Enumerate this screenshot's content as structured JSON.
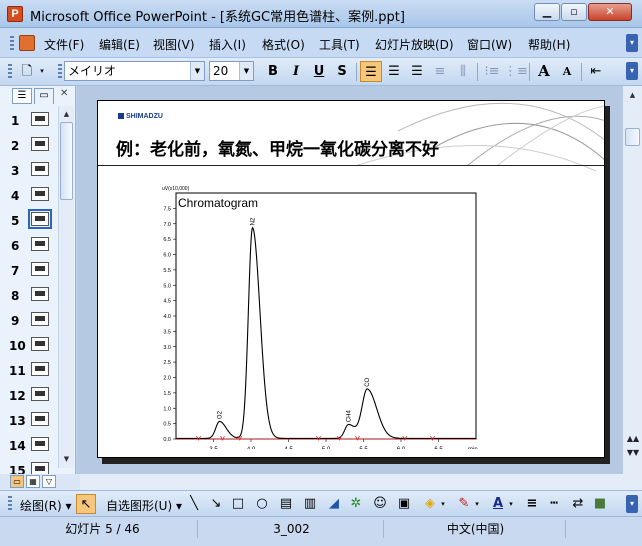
{
  "window": {
    "title": "Microsoft Office PowerPoint - [系统GC常用色谱柱、案例.ppt]",
    "minimize": "▁",
    "restore": "▫",
    "close": "✕"
  },
  "menu": [
    "文件(F)",
    "编辑(E)",
    "视图(V)",
    "插入(I)",
    "格式(O)",
    "工具(T)",
    "幻灯片放映(D)",
    "窗口(W)",
    "帮助(H)"
  ],
  "toolbar": {
    "font_name": "メイリオ",
    "font_size": "20",
    "bold": "B",
    "italic": "I",
    "underline": "U",
    "shadow": "S",
    "grow_font": "A",
    "shrink_font": "A"
  },
  "slides": {
    "numbers": [
      "1",
      "2",
      "3",
      "4",
      "5",
      "6",
      "7",
      "8",
      "9",
      "10",
      "11",
      "12",
      "13",
      "14",
      "15"
    ],
    "selected": 5
  },
  "slide": {
    "logo": "SHIMADZU",
    "title": "例：老化前，氧氮、甲烷一氧化碳分离不好"
  },
  "chart_data": {
    "type": "line",
    "title": "Chromatogram",
    "ylabel": "uV(x10,000)",
    "xlabel": "min",
    "xlim": [
      3.0,
      7.0
    ],
    "ylim": [
      0,
      8.0
    ],
    "x_ticks": [
      "3.5",
      "4.0",
      "4.5",
      "5.0",
      "5.5",
      "6.0",
      "6.5"
    ],
    "y_ticks": [
      "0.0",
      "0.5",
      "1.0",
      "1.5",
      "2.0",
      "2.5",
      "3.0",
      "3.5",
      "4.0",
      "4.5",
      "5.0",
      "5.5",
      "6.0",
      "6.5",
      "7.0",
      "7.5"
    ],
    "peaks": [
      {
        "label": "O2",
        "rt": 3.58,
        "height": 0.55,
        "width": 0.05
      },
      {
        "label": "N2",
        "rt": 4.02,
        "height": 6.85,
        "width": 0.055
      },
      {
        "label": "CH4",
        "rt": 5.3,
        "height": 0.45,
        "width": 0.05
      },
      {
        "label": "CO",
        "rt": 5.55,
        "height": 1.6,
        "width": 0.07
      }
    ],
    "series": [
      {
        "color": "#000000"
      }
    ],
    "baseline_marks": [
      3.3,
      3.62,
      3.85,
      4.9,
      5.18,
      5.42,
      6.05,
      6.42
    ],
    "mark_color": "#e02020"
  },
  "drawbar": {
    "draw_label": "绘图(R) ▾",
    "autoshape_label": "自选图形(U) ▾"
  },
  "status": {
    "slide": "幻灯片 5 / 46",
    "design": "3_002",
    "language": "中文(中国)"
  }
}
